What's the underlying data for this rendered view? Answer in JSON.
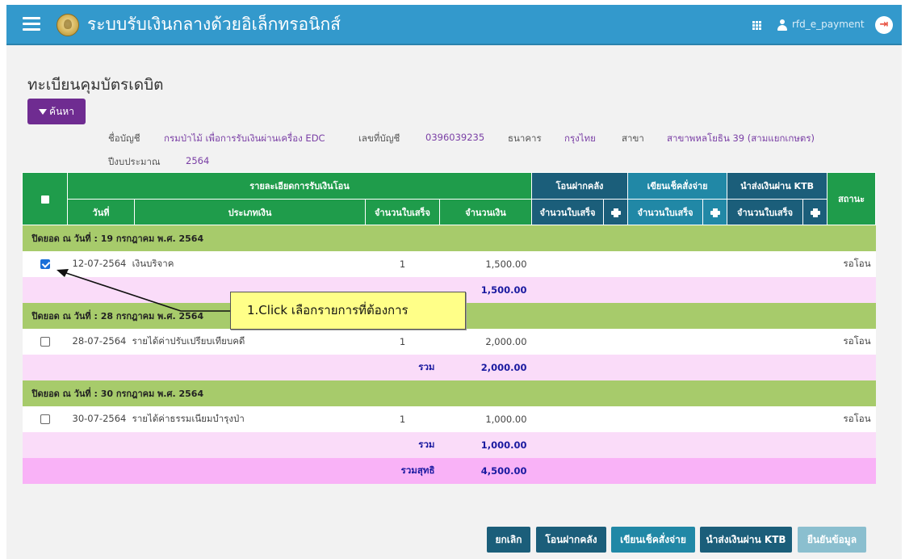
{
  "app": {
    "title": "ระบบรับเงินกลางด้วยอิเล็กทรอนิกส์",
    "username": "rfd_e_payment"
  },
  "icons": {
    "menu": "hamburger-icon",
    "logo": "department-seal",
    "apps": "grid-icon",
    "user": "user-icon",
    "logout": "logout-icon",
    "filter": "filter-icon",
    "print": "print-icon"
  },
  "page": {
    "title": "ทะเบียนคุมบัตรเดบิต",
    "search_label": "ค้นหา"
  },
  "account": {
    "name_label": "ชื่อบัญชี",
    "name": "กรมป่าไม้ เพื่อการรับเงินผ่านเครื่อง EDC",
    "number_label": "เลขที่บัญชี",
    "number": "0396039235",
    "bank_label": "ธนาคาร",
    "bank": "กรุงไทย",
    "branch_label": "สาขา",
    "branch": "สาขาพหลโยธิน 39 (สามแยกเกษตร)",
    "year_label": "ปีงบประมาณ",
    "year": "2564"
  },
  "table": {
    "head": {
      "detail": "รายละเอียดการรับเงินโอน",
      "deposit": "โอนฝากคลัง",
      "cheque": "เขียนเช็คสั่งจ่าย",
      "ktb": "นำส่งเงินผ่าน KTB",
      "status": "สถานะ",
      "date": "วันที่",
      "type": "ประเภทเงิน",
      "receipts": "จำนวนใบเสร็จ",
      "amount": "จำนวนเงิน"
    },
    "groups": [
      {
        "header": "ปิดยอด ณ วันที่ : 19 กรกฎาคม พ.ศ. 2564",
        "row": {
          "date": "12-07-2564",
          "type": "เงินบริจาค",
          "count": "1",
          "amount": "1,500.00",
          "status": "รอโอน",
          "checked": true
        },
        "subtotal_label": "",
        "subtotal": "1,500.00"
      },
      {
        "header": "ปิดยอด ณ วันที่ : 28 กรกฎาคม พ.ศ. 2564",
        "row": {
          "date": "28-07-2564",
          "type": "รายได้ค่าปรับเปรียบเทียบคดี",
          "count": "1",
          "amount": "2,000.00",
          "status": "รอโอน",
          "checked": false
        },
        "subtotal_label": "รวม",
        "subtotal": "2,000.00"
      },
      {
        "header": "ปิดยอด ณ วันที่ : 30 กรกฎาคม พ.ศ. 2564",
        "row": {
          "date": "30-07-2564",
          "type": "รายได้ค่าธรรมเนียมบำรุงป่า",
          "count": "1",
          "amount": "1,000.00",
          "status": "รอโอน",
          "checked": false
        },
        "subtotal_label": "รวม",
        "subtotal": "1,000.00"
      }
    ],
    "net_label": "รวมสุทธิ",
    "net_total": "4,500.00"
  },
  "callout": {
    "text": "1.Click เลือกรายการที่ต้องการ"
  },
  "buttons": {
    "cancel": "ยกเลิก",
    "deposit": "โอนฝากคลัง",
    "cheque": "เขียนเช็คสั่งจ่าย",
    "ktb": "นำส่งเงินผ่าน KTB",
    "confirm": "ยืนยันข้อมูล"
  },
  "colors": {
    "header_bar": "#3399cc",
    "search_button": "#6f2c91",
    "group_row": "#a7cb6b",
    "subtotal_row": "#fadcf9",
    "net_row": "#f9b2f7",
    "header_green": "#1f9c4b",
    "header_navy": "#1b5e7a",
    "header_teal": "#2188a6"
  }
}
